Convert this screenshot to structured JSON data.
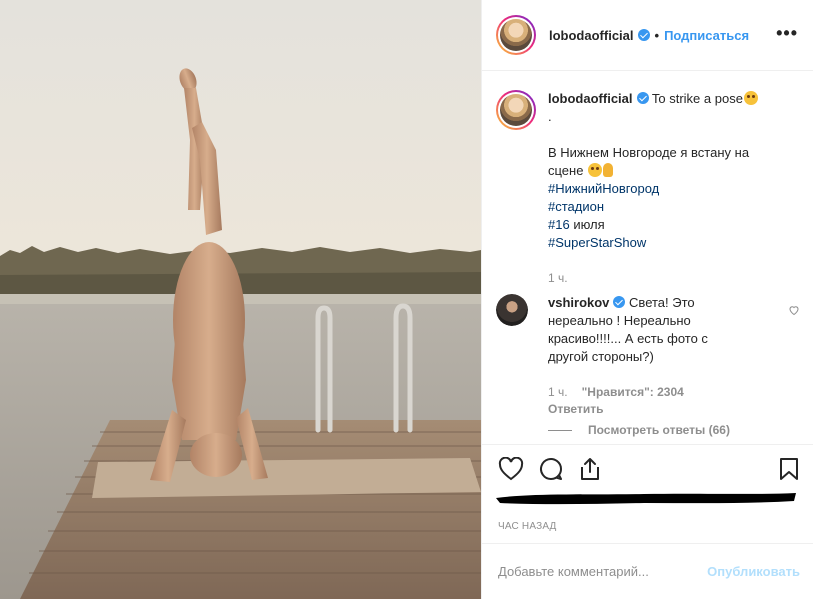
{
  "header": {
    "username": "lobodaofficial",
    "separator": "•",
    "follow_label": "Подписаться",
    "more_label": "•••"
  },
  "caption": {
    "username": "lobodaofficial",
    "title": "To strike a pose",
    "dot_line": ".",
    "line1": "В Нижнем Новгороде я встану на",
    "line2": "сцене",
    "hashtags": [
      "#НижнийНовгород",
      "#стадион"
    ],
    "hashtag3": "#16",
    "hashtag3_rest": " июля",
    "hashtag4": "#SuperStarShow",
    "time": "1 ч."
  },
  "comment": {
    "username": "vshirokov",
    "text": "Света! Это нереально ! Нереально красиво!!!!... А есть фото с другой стороны?)",
    "time": "1 ч.",
    "likes": "\"Нравится\": 2304",
    "reply_label": "Ответить",
    "view_replies": "Посмотреть ответы (66)"
  },
  "actions": {
    "icons": [
      "heart-icon",
      "comment-icon",
      "share-icon",
      "bookmark-icon"
    ]
  },
  "post_time": "Час назад",
  "add_comment": {
    "placeholder": "Добавьте комментарий...",
    "publish_label": "Опубликовать"
  },
  "colors": {
    "accent": "#3897f0",
    "publish_disabled": "#b2dffc",
    "hashtag": "#003569",
    "muted": "#8e8e8e"
  }
}
